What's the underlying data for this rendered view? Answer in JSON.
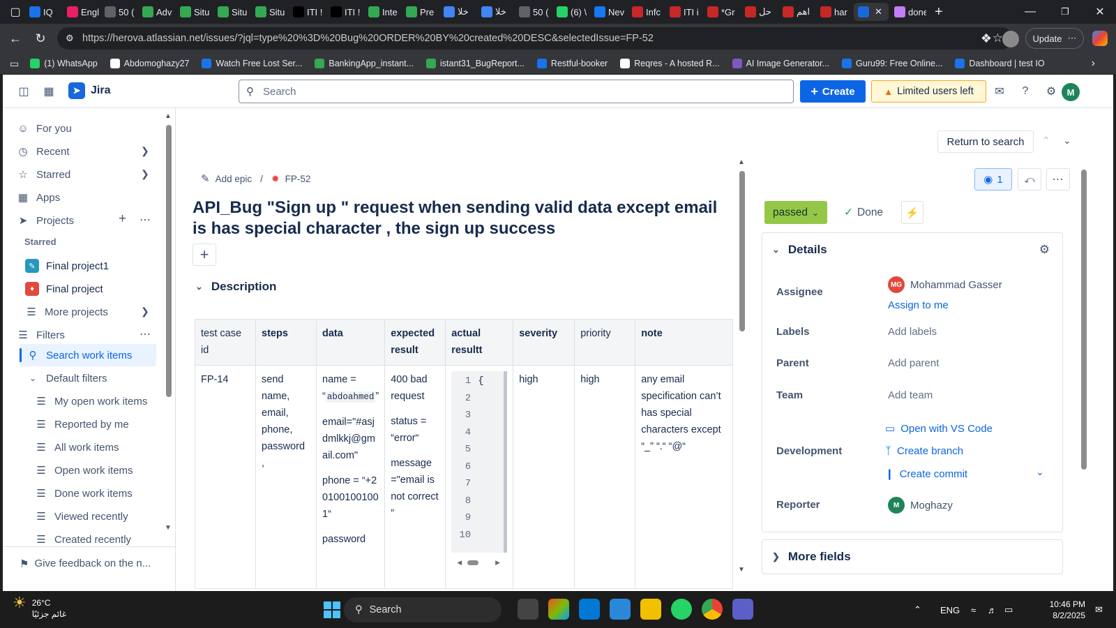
{
  "browser": {
    "tabs": [
      "IQ",
      "Engli",
      "50 (",
      "Adv",
      "Situ",
      "Situ",
      "Situ",
      "ITI !",
      "ITI !",
      "Inte",
      "Pre",
      "خلا",
      "خلا",
      "50 (",
      "(6) \\",
      "Nev",
      "Infc",
      "ITI i",
      "*Gr",
      "حل",
      "اهم",
      "har",
      "",
      "done"
    ],
    "url": "https://herova.atlassian.net/issues/?jql=type%20%3D%20Bug%20ORDER%20BY%20created%20DESC&selectedIssue=FP-52",
    "update_label": "Update",
    "bookmarks": [
      "(1) WhatsApp",
      "Abdomoghazy27",
      "Watch Free Lost Ser...",
      "BankingApp_instant...",
      "istant31_BugReport...",
      "Restful-booker",
      "Reqres - A hosted R...",
      "AI Image Generator...",
      "Guru99: Free Online...",
      "Dashboard | test IO"
    ]
  },
  "jira": {
    "product": "Jira",
    "search_placeholder": "Search",
    "create_label": "Create",
    "limited_label": "Limited users left",
    "avatar_initial": "M"
  },
  "sidebar": {
    "for_you": "For you",
    "recent": "Recent",
    "starred": "Starred",
    "apps": "Apps",
    "projects": "Projects",
    "starred_heading": "Starred",
    "project1": "Final project1",
    "project2": "Final project",
    "more_projects": "More projects",
    "filters": "Filters",
    "search_work_items": "Search work items",
    "default_filters": "Default filters",
    "filter_items": [
      "My open work items",
      "Reported by me",
      "All work items",
      "Open work items",
      "Done work items",
      "Viewed recently",
      "Created recently"
    ],
    "feedback": "Give feedback on the n..."
  },
  "issue": {
    "return_label": "Return to search",
    "add_epic": "Add epic",
    "key": "FP-52",
    "title": "API_Bug \"Sign up \" request when sending valid data except email is has special character , the sign up success",
    "description_label": "Description",
    "table": {
      "headers": [
        "test case id",
        "steps",
        "data",
        "expected result",
        "actual resultt",
        "severity",
        "priority",
        "note"
      ],
      "row": {
        "id": "FP-14",
        "steps": "send name, email, phone, password ,",
        "data_name_prefix": "name = “",
        "data_name_code": "abdoahmed",
        "data_name_suffix": "”",
        "data_email": "email=\"#asjdmlkkj@gmail.com\"",
        "data_phone": "phone = “+201001001001“",
        "data_password": "password",
        "expected_1": "400 bad request",
        "expected_2": "status = “error“",
        "expected_3": "message =\"email is not correct ”",
        "code_lines": [
          "1",
          "2",
          "3",
          "4",
          "5",
          "6",
          "7",
          "8",
          "9",
          "10"
        ],
        "code_first": "{",
        "severity": "high",
        "priority": "high",
        "note": "any email specification can’t has special characters except “_” “.“ “@“"
      }
    }
  },
  "panel": {
    "watch_count": "1",
    "status": "passed",
    "done_label": "Done",
    "details_label": "Details",
    "assignee_label": "Assignee",
    "assignee_name": "Mohammad Gasser",
    "assignee_initials": "MG",
    "assign_to_me": "Assign to me",
    "labels_label": "Labels",
    "labels_value": "Add labels",
    "parent_label": "Parent",
    "parent_value": "Add parent",
    "team_label": "Team",
    "team_value": "Add team",
    "development_label": "Development",
    "open_vscode": "Open with VS Code",
    "create_branch": "Create branch",
    "create_commit": "Create commit",
    "reporter_label": "Reporter",
    "reporter_name": "Moghazy",
    "reporter_initial": "M",
    "more_fields": "More fields"
  },
  "taskbar": {
    "temp": "26°C",
    "weather": "غائم جزئيًا",
    "search": "Search",
    "lang": "ENG",
    "time": "10:46 PM",
    "date": "8/2/2025"
  },
  "colors": {
    "accent": "#0c66e4",
    "status_green": "#94c748",
    "warning": "#f5a623"
  }
}
